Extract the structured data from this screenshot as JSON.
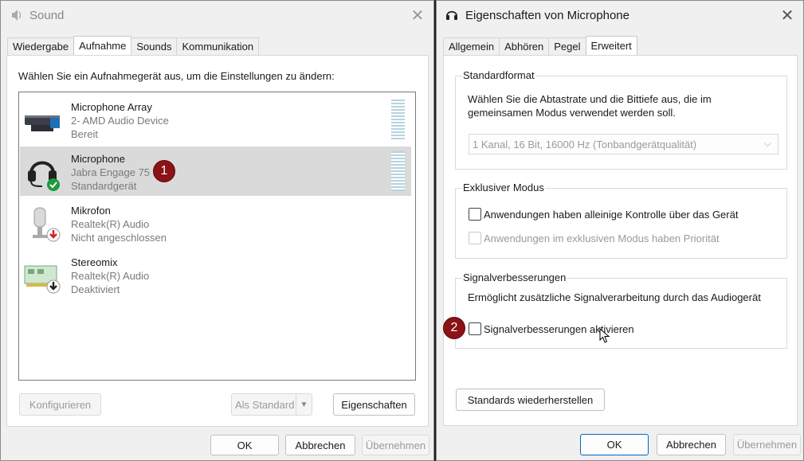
{
  "sound_window": {
    "title": "Sound",
    "tabs": [
      "Wiedergabe",
      "Aufnahme",
      "Sounds",
      "Kommunikation"
    ],
    "instruction": "Wählen Sie ein Aufnahmegerät aus, um die Einstellungen zu ändern:",
    "devices": [
      {
        "name": "Microphone Array",
        "sub": "2- AMD Audio Device",
        "status": "Bereit"
      },
      {
        "name": "Microphone",
        "sub": "Jabra Engage 75",
        "status": "Standardgerät"
      },
      {
        "name": "Mikrofon",
        "sub": "Realtek(R) Audio",
        "status": "Nicht angeschlossen"
      },
      {
        "name": "Stereomix",
        "sub": "Realtek(R) Audio",
        "status": "Deaktiviert"
      }
    ],
    "buttons": {
      "configure": "Konfigurieren",
      "set_default": "Als Standard",
      "properties": "Eigenschaften",
      "ok": "OK",
      "cancel": "Abbrechen",
      "apply": "Übernehmen"
    },
    "badge": "1"
  },
  "props_window": {
    "title": "Eigenschaften von Microphone",
    "tabs": [
      "Allgemein",
      "Abhören",
      "Pegel",
      "Erweitert"
    ],
    "default_format": {
      "label": "Standardformat",
      "desc_line1": "Wählen Sie die Abtastrate und die Bittiefe aus, die im",
      "desc_line2": "gemeinsamen Modus verwendet werden soll.",
      "selected": "1 Kanal, 16 Bit, 16000 Hz (Tonbandgerätqualität)"
    },
    "exclusive": {
      "label": "Exklusiver Modus",
      "opt1": "Anwendungen haben alleinige Kontrolle über das Gerät",
      "opt2": "Anwendungen im exklusiven Modus haben Priorität"
    },
    "enhancements": {
      "label": "Signalverbesserungen",
      "desc": "Ermöglicht zusätzliche Signalverarbeitung durch das Audiogerät",
      "opt": "Signalverbesserungen aktivieren"
    },
    "buttons": {
      "restore": "Standards wiederherstellen",
      "ok": "OK",
      "cancel": "Abbrechen",
      "apply": "Übernehmen"
    },
    "badge": "2"
  },
  "colors": {
    "badge": "#8b1216",
    "selection": "#dadada",
    "accent": "#0067c0"
  }
}
